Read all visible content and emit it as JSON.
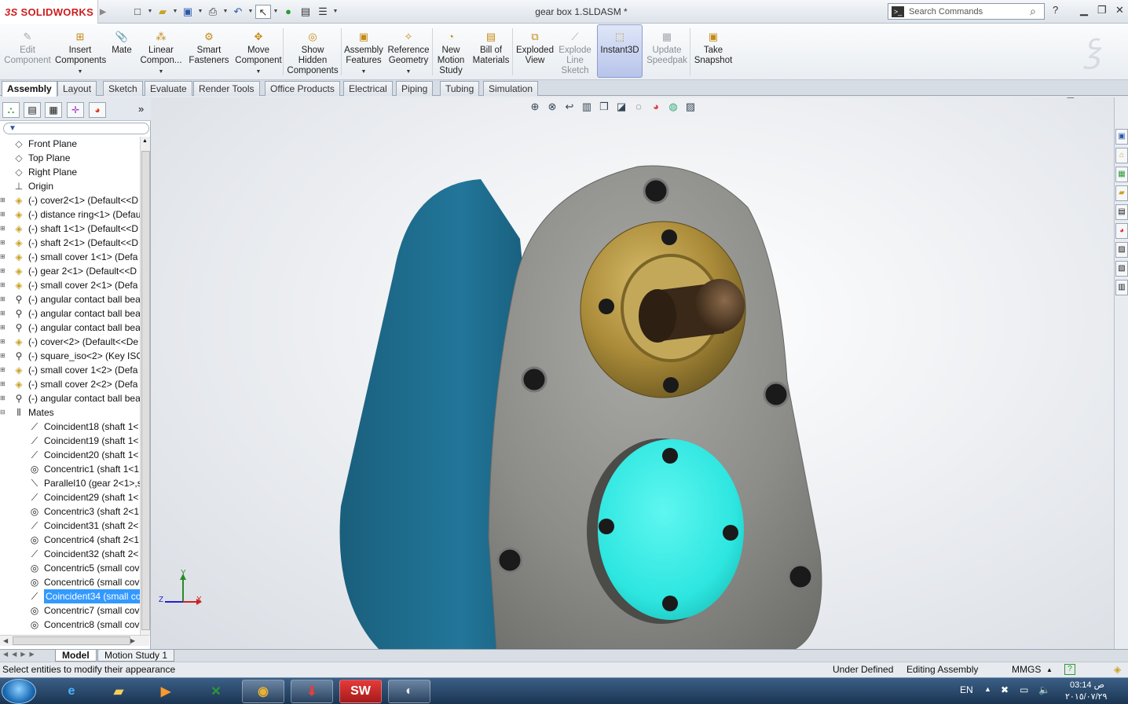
{
  "app": {
    "logo_ds": "3S",
    "logo_text": "SOLIDWORKS",
    "doc_title": "gear box 1.SLDASM *"
  },
  "search": {
    "placeholder": "Search Commands",
    "help": "?"
  },
  "commands": [
    {
      "label": "Edit\nComponent",
      "icon": "edit-component-icon",
      "dim": true
    },
    {
      "label": "Insert\nComponents",
      "icon": "insert-components-icon"
    },
    {
      "label": "Mate",
      "icon": "mate-icon"
    },
    {
      "label": "Linear\nCompon...",
      "icon": "linear-pattern-icon"
    },
    {
      "label": "Smart\nFasteners",
      "icon": "smart-fasteners-icon"
    },
    {
      "label": "Move\nComponent",
      "icon": "move-component-icon"
    },
    {
      "label": "Show\nHidden\nComponents",
      "icon": "show-hidden-icon"
    },
    {
      "label": "Assembly\nFeatures",
      "icon": "assembly-features-icon"
    },
    {
      "label": "Reference\nGeometry",
      "icon": "reference-geometry-icon"
    },
    {
      "label": "New\nMotion\nStudy",
      "icon": "motion-study-icon"
    },
    {
      "label": "Bill of\nMaterials",
      "icon": "bom-icon"
    },
    {
      "label": "Exploded\nView",
      "icon": "exploded-view-icon"
    },
    {
      "label": "Explode\nLine\nSketch",
      "icon": "explode-line-icon",
      "dim": true
    },
    {
      "label": "Instant3D",
      "icon": "instant3d-icon"
    },
    {
      "label": "Update\nSpeedpak",
      "icon": "speedpak-icon",
      "dim": true
    },
    {
      "label": "Take\nSnapshot",
      "icon": "snapshot-icon"
    }
  ],
  "tabs": [
    "Assembly",
    "Layout",
    "Sketch",
    "Evaluate",
    "Render Tools",
    "Office Products",
    "Electrical",
    "Piping",
    "Tubing",
    "Simulation"
  ],
  "tree": [
    {
      "label": "Front Plane",
      "type": "plane"
    },
    {
      "label": "Top Plane",
      "type": "plane"
    },
    {
      "label": "Right Plane",
      "type": "plane"
    },
    {
      "label": "Origin",
      "type": "origin"
    },
    {
      "label": "(-) cover2<1> (Default<<D",
      "type": "part"
    },
    {
      "label": "(-) distance ring<1> (Defau",
      "type": "part"
    },
    {
      "label": "(-) shaft 1<1> (Default<<D",
      "type": "part"
    },
    {
      "label": "(-) shaft 2<1> (Default<<D",
      "type": "part"
    },
    {
      "label": "(-) small cover 1<1> (Defa",
      "type": "part"
    },
    {
      "label": "(-) gear 2<1> (Default<<D",
      "type": "part"
    },
    {
      "label": "(-) small cover 2<1> (Defa",
      "type": "part"
    },
    {
      "label": "(-) angular contact ball bea",
      "type": "bearing"
    },
    {
      "label": "(-) angular contact ball bea",
      "type": "bearing"
    },
    {
      "label": "(-) angular contact ball bea",
      "type": "bearing"
    },
    {
      "label": "(-) cover<2> (Default<<De",
      "type": "part"
    },
    {
      "label": "(-) square_iso<2> (Key ISO",
      "type": "bearing"
    },
    {
      "label": "(-) small cover 1<2> (Defa",
      "type": "part"
    },
    {
      "label": "(-) small cover 2<2> (Defa",
      "type": "part"
    },
    {
      "label": "(-) angular contact ball bea",
      "type": "bearing"
    },
    {
      "label": "Mates",
      "type": "mates"
    },
    {
      "label": "Coincident18 (shaft 1<",
      "type": "coincident"
    },
    {
      "label": "Coincident19 (shaft 1<",
      "type": "coincident"
    },
    {
      "label": "Coincident20 (shaft 1<",
      "type": "coincident"
    },
    {
      "label": "Concentric1 (shaft 1<1",
      "type": "concentric"
    },
    {
      "label": "Parallel10 (gear 2<1>,s",
      "type": "parallel"
    },
    {
      "label": "Coincident29 (shaft 1<",
      "type": "coincident"
    },
    {
      "label": "Concentric3 (shaft 2<1",
      "type": "concentric"
    },
    {
      "label": "Coincident31 (shaft 2<",
      "type": "coincident"
    },
    {
      "label": "Concentric4 (shaft 2<1",
      "type": "concentric"
    },
    {
      "label": "Coincident32 (shaft 2<",
      "type": "coincident"
    },
    {
      "label": "Concentric5 (small cov",
      "type": "concentric"
    },
    {
      "label": "Concentric6 (small cov",
      "type": "concentric"
    },
    {
      "label": "Coincident34 (small co",
      "type": "coincident",
      "selected": true
    },
    {
      "label": "Concentric7 (small cov",
      "type": "concentric"
    },
    {
      "label": "Concentric8 (small cov",
      "type": "concentric"
    }
  ],
  "triad": {
    "x": "X",
    "y": "Y",
    "z": "Z"
  },
  "bottom_tabs": [
    "Model",
    "Motion Study 1"
  ],
  "status": {
    "message": "Select entities to modify their appearance",
    "definition": "Under Defined",
    "mode": "Editing Assembly",
    "units": "MMGS",
    "help": "?"
  },
  "taskbar": {
    "lang": "EN",
    "time": "03:14 ص",
    "date": "٢٠١٥/٠٧/٢٩",
    "sw_label": "SW"
  },
  "colors": {
    "housing_side": "#1f6a86",
    "plate": "#8f8f8c",
    "brass": "#a88a3c",
    "cyan_cover": "#2ee6e0",
    "selection": "#3399ff"
  }
}
